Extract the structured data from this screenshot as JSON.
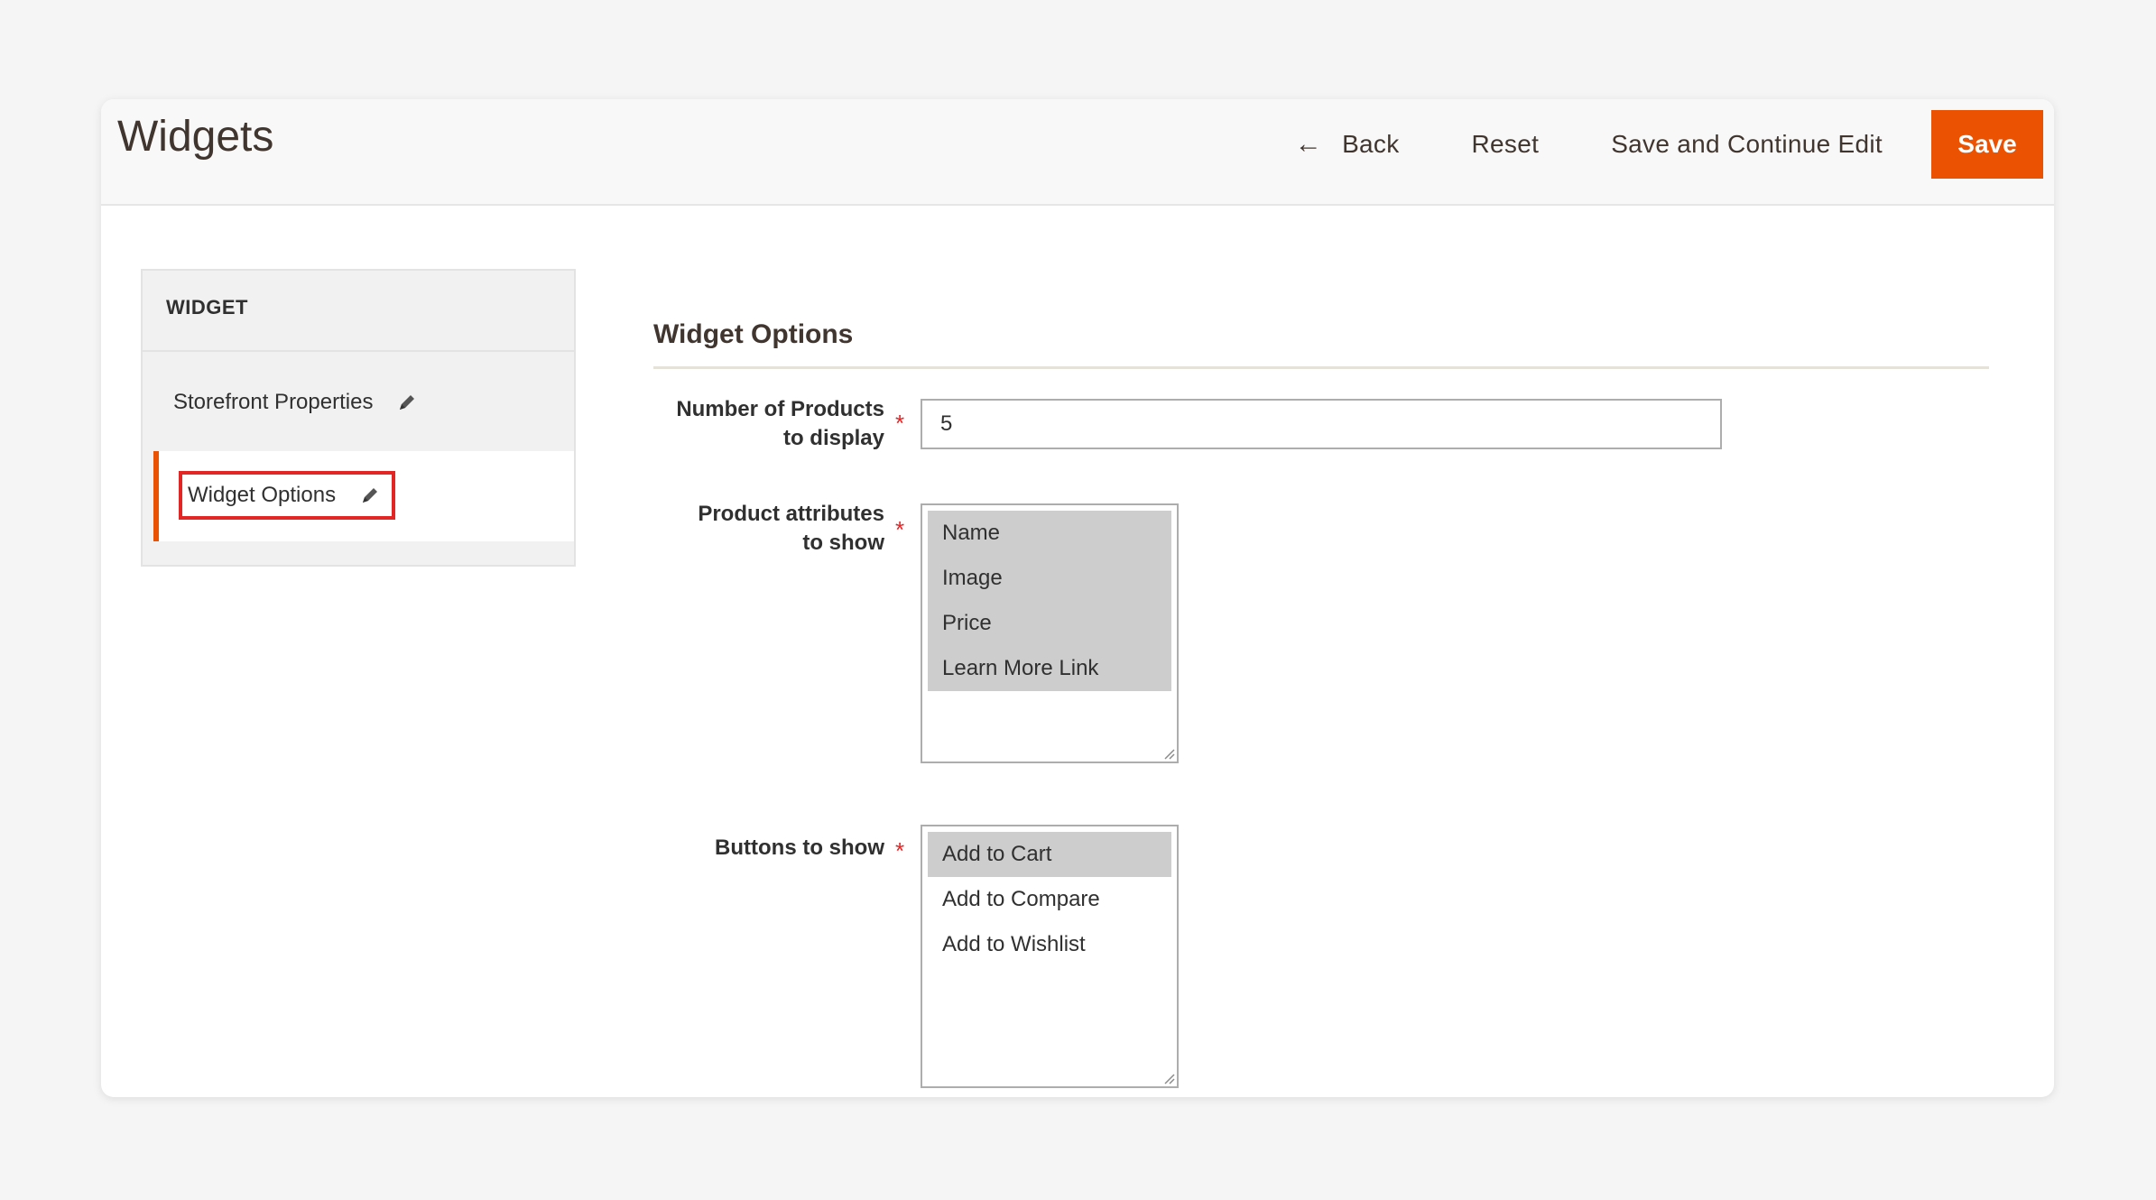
{
  "header": {
    "title": "Widgets",
    "back_label": "Back",
    "reset_label": "Reset",
    "save_continue_label": "Save and Continue Edit",
    "save_label": "Save"
  },
  "sidebar": {
    "title": "WIDGET",
    "items": [
      {
        "label": "Storefront Properties",
        "active": false
      },
      {
        "label": "Widget Options",
        "active": true
      }
    ]
  },
  "form": {
    "section_title": "Widget Options",
    "number_of_products": {
      "label_line1": "Number of Products",
      "label_line2": "to display",
      "value": "5"
    },
    "product_attributes": {
      "label_line1": "Product attributes",
      "label_line2": "to show",
      "options": [
        {
          "label": "Name",
          "selected": true
        },
        {
          "label": "Image",
          "selected": true
        },
        {
          "label": "Price",
          "selected": true
        },
        {
          "label": "Learn More Link",
          "selected": true
        }
      ]
    },
    "buttons_to_show": {
      "label": "Buttons to show",
      "options": [
        {
          "label": "Add to Cart",
          "selected": true
        },
        {
          "label": "Add to Compare",
          "selected": false
        },
        {
          "label": "Add to Wishlist",
          "selected": false
        }
      ]
    },
    "required_marker": "*"
  },
  "colors": {
    "accent": "#eb5202",
    "highlight_border": "#e22626",
    "selected_option_bg": "#cdcdcd"
  },
  "icons": {
    "back": "arrow-left-icon",
    "edit": "pencil-icon",
    "resize": "resize-grip-icon"
  }
}
